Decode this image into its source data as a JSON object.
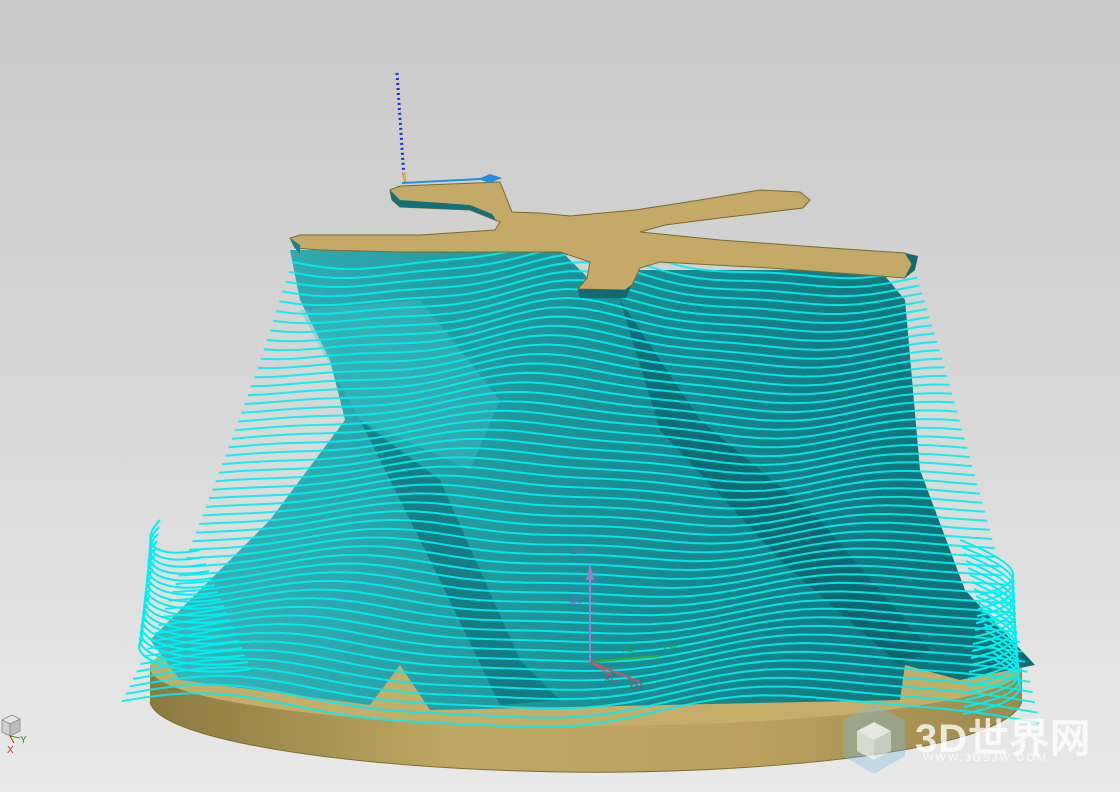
{
  "viewport": {
    "model": "impeller-toolpath",
    "colors": {
      "background_top": "#c9c9c9",
      "background_bottom": "#e9e9e9",
      "toolpath": "#00f0f0",
      "blade": "#1f8f95",
      "blade_dark": "#0f5f66",
      "hub": "#b89f5c",
      "hub_top": "#c4a967"
    }
  },
  "wcs": {
    "zm": "ZM",
    "zc": "ZC",
    "yc": "YC",
    "ym": "YM",
    "xc": "XC",
    "xm": "XM"
  },
  "view_triad": {
    "y": "Y",
    "x": "X"
  },
  "watermark": {
    "brand": "3D世界网",
    "url": "WWW.3DSJW.COM"
  }
}
